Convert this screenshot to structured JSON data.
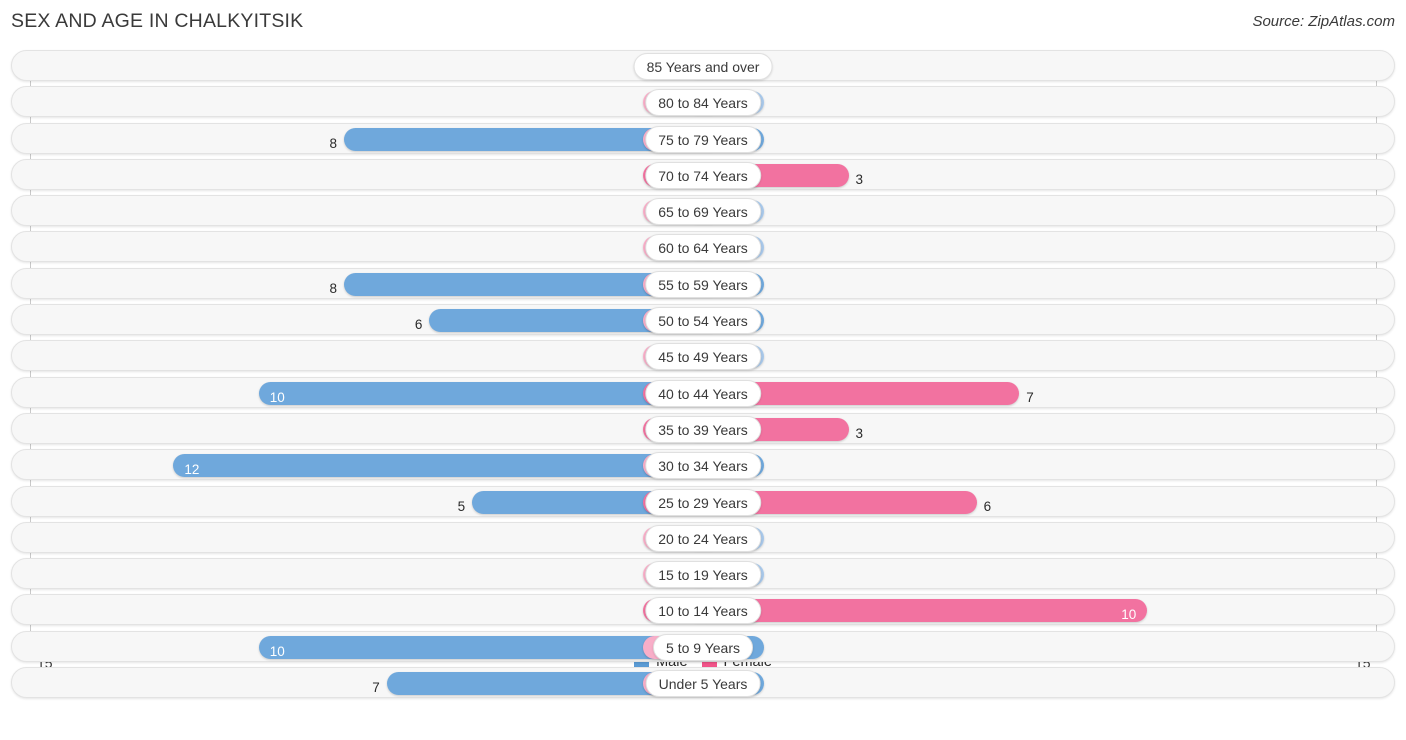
{
  "header": {
    "title": "SEX AND AGE IN CHALKYITSIK",
    "source": "Source: ZipAtlas.com"
  },
  "legend": {
    "male_label": "Male",
    "female_label": "Female",
    "male_color": "#5b9bd5",
    "female_color": "#f2548a"
  },
  "axis": {
    "left_tick": "15",
    "right_tick": "15",
    "max": 15
  },
  "chart_data": {
    "type": "bar",
    "title": "SEX AND AGE IN CHALKYITSIK",
    "subtitle": "",
    "xlabel": "",
    "ylabel": "",
    "orientation": "horizontal",
    "style": "population-pyramid",
    "xlim": [
      15,
      0,
      15
    ],
    "grid": true,
    "legend_position": "bottom-center",
    "categories": [
      "85 Years and over",
      "80 to 84 Years",
      "75 to 79 Years",
      "70 to 74 Years",
      "65 to 69 Years",
      "60 to 64 Years",
      "55 to 59 Years",
      "50 to 54 Years",
      "45 to 49 Years",
      "40 to 44 Years",
      "35 to 39 Years",
      "30 to 34 Years",
      "25 to 29 Years",
      "20 to 24 Years",
      "15 to 19 Years",
      "10 to 14 Years",
      "5 to 9 Years",
      "Under 5 Years"
    ],
    "series": [
      {
        "name": "Male",
        "values": [
          0,
          0,
          8,
          0,
          0,
          0,
          8,
          6,
          0,
          10,
          0,
          12,
          5,
          0,
          0,
          0,
          10,
          7
        ]
      },
      {
        "name": "Female",
        "values": [
          0,
          0,
          0,
          3,
          0,
          0,
          0,
          0,
          0,
          7,
          3,
          0,
          6,
          0,
          0,
          10,
          0,
          0
        ]
      }
    ]
  },
  "rows": [
    {
      "age": "85 Years and over",
      "male": "0",
      "female": "0"
    },
    {
      "age": "80 to 84 Years",
      "male": "0",
      "female": "0"
    },
    {
      "age": "75 to 79 Years",
      "male": "8",
      "female": "0"
    },
    {
      "age": "70 to 74 Years",
      "male": "0",
      "female": "3"
    },
    {
      "age": "65 to 69 Years",
      "male": "0",
      "female": "0"
    },
    {
      "age": "60 to 64 Years",
      "male": "0",
      "female": "0"
    },
    {
      "age": "55 to 59 Years",
      "male": "8",
      "female": "0"
    },
    {
      "age": "50 to 54 Years",
      "male": "6",
      "female": "0"
    },
    {
      "age": "45 to 49 Years",
      "male": "0",
      "female": "0"
    },
    {
      "age": "40 to 44 Years",
      "male": "10",
      "female": "7"
    },
    {
      "age": "35 to 39 Years",
      "male": "0",
      "female": "3"
    },
    {
      "age": "30 to 34 Years",
      "male": "12",
      "female": "0"
    },
    {
      "age": "25 to 29 Years",
      "male": "5",
      "female": "6"
    },
    {
      "age": "20 to 24 Years",
      "male": "0",
      "female": "0"
    },
    {
      "age": "15 to 19 Years",
      "male": "0",
      "female": "0"
    },
    {
      "age": "10 to 14 Years",
      "male": "0",
      "female": "10"
    },
    {
      "age": "5 to 9 Years",
      "male": "10",
      "female": "0"
    },
    {
      "age": "Under 5 Years",
      "male": "7",
      "female": "0"
    }
  ]
}
